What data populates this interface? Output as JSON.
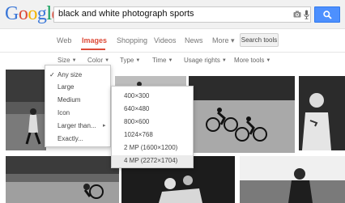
{
  "logo": {
    "letters": [
      "G",
      "o",
      "o",
      "g",
      "l",
      "e"
    ],
    "colors": [
      "#3c78d8",
      "#dd4b39",
      "#f4b400",
      "#3c78d8",
      "#0f9d58",
      "#dd4b39"
    ]
  },
  "search": {
    "query": "black and white photograph sports"
  },
  "icons": {
    "camera": "camera-icon",
    "mic": "microphone-icon",
    "search": "search-icon"
  },
  "tabs": [
    {
      "label": "Web",
      "active": false
    },
    {
      "label": "Images",
      "active": true
    },
    {
      "label": "Shopping",
      "active": false
    },
    {
      "label": "Videos",
      "active": false
    },
    {
      "label": "News",
      "active": false
    },
    {
      "label": "More ▾",
      "active": false
    }
  ],
  "search_tools_label": "Search tools",
  "tools": [
    {
      "label": "Size"
    },
    {
      "label": "Color"
    },
    {
      "label": "Type"
    },
    {
      "label": "Time"
    },
    {
      "label": "Usage rights"
    },
    {
      "label": "More tools"
    }
  ],
  "size_menu": {
    "items": [
      {
        "label": "Any size",
        "checked": true
      },
      {
        "label": "Large"
      },
      {
        "label": "Medium"
      },
      {
        "label": "Icon"
      },
      {
        "label": "Larger than...",
        "submenu": true
      },
      {
        "label": "Exactly..."
      }
    ],
    "check": "✓",
    "arrow": "▸"
  },
  "larger_than_menu": {
    "items": [
      {
        "label": "400×300"
      },
      {
        "label": "640×480"
      },
      {
        "label": "800×600"
      },
      {
        "label": "1024×768"
      },
      {
        "label": "2 MP (1600×1200)"
      },
      {
        "label": "4 MP (2272×1704)",
        "highlighted": true
      }
    ]
  },
  "colors": {
    "accent_red": "#dd4b39",
    "button_blue": "#4d90fe",
    "header_bg": "#f1f1f1"
  }
}
